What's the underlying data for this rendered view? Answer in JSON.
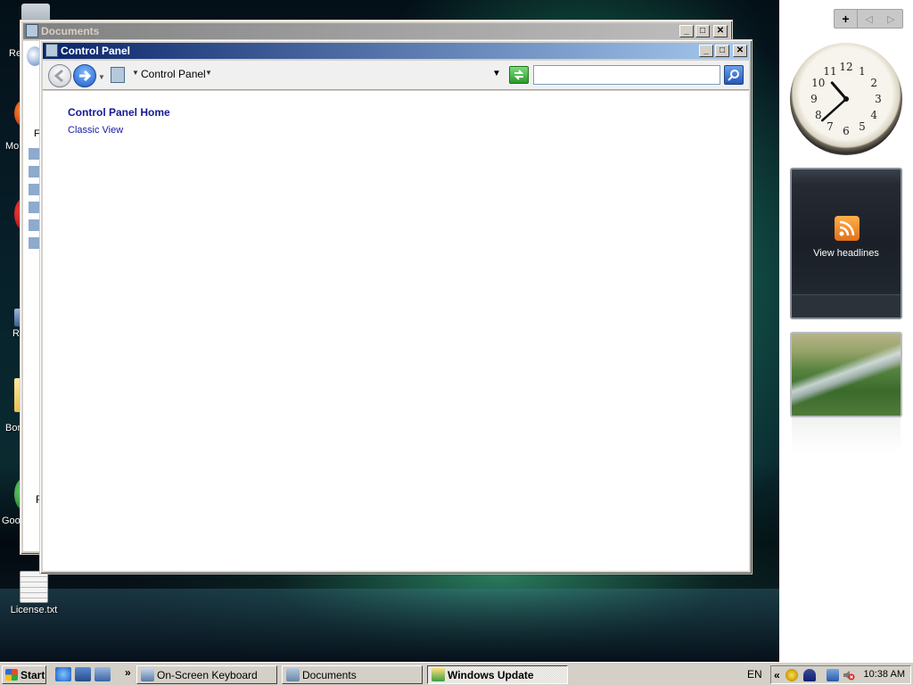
{
  "desktop": {
    "icons": [
      {
        "label": "License.txt"
      }
    ],
    "partial_labels": [
      "Re",
      "Mo",
      "R",
      "Bon",
      "Goo"
    ]
  },
  "sidebar": {
    "controls": {
      "add": "+",
      "prev": "◁",
      "next": "▷"
    },
    "clock": {
      "numerals": [
        "12",
        "1",
        "2",
        "3",
        "4",
        "5",
        "6",
        "7",
        "8",
        "9",
        "10",
        "11"
      ],
      "hour": 10,
      "minute": 38
    },
    "feed": {
      "label": "View headlines"
    }
  },
  "documents_window": {
    "title": "Documents",
    "side_letters": [
      "Fa",
      "F"
    ]
  },
  "control_panel_window": {
    "title": "Control Panel",
    "caption_buttons": {
      "minimize": "_",
      "maximize": "□",
      "close": "✕"
    },
    "toolbar": {
      "breadcrumb": "Control Panel",
      "search_value": ""
    },
    "content": {
      "home_link": "Control Panel Home",
      "classic_link": "Classic View"
    }
  },
  "taskbar": {
    "start_label": "Start",
    "overflow": "»",
    "buttons": [
      {
        "label": "On-Screen Keyboard",
        "active": false
      },
      {
        "label": "Documents",
        "active": false
      },
      {
        "label": "Windows Update",
        "active": true
      }
    ],
    "language": "EN",
    "tray_overflow": "«",
    "time": "10:38 AM"
  },
  "colors": {
    "title_active": "#0a246a",
    "link": "#15199a",
    "face": "#d4d0c8"
  }
}
